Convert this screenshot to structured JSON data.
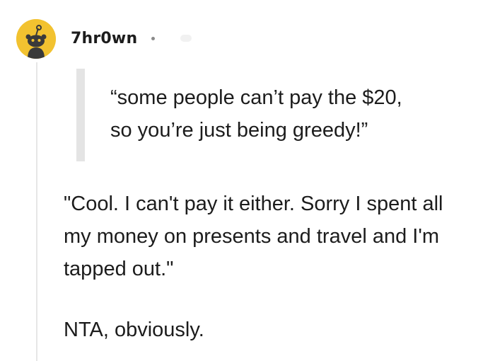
{
  "comment": {
    "username": "7hr0wn",
    "avatar_icon": "reddit-snoo-avatar-icon",
    "avatar_color": "#f2c230",
    "quote_lines": [
      "“some people can’t pay the $20,",
      "so you’re just being greedy!”"
    ],
    "body_lines": [
      "\"Cool. I can't pay it either. Sorry I spent all",
      "my money on presents and travel and I'm",
      "tapped out.\""
    ],
    "verdict": "NTA, obviously."
  }
}
